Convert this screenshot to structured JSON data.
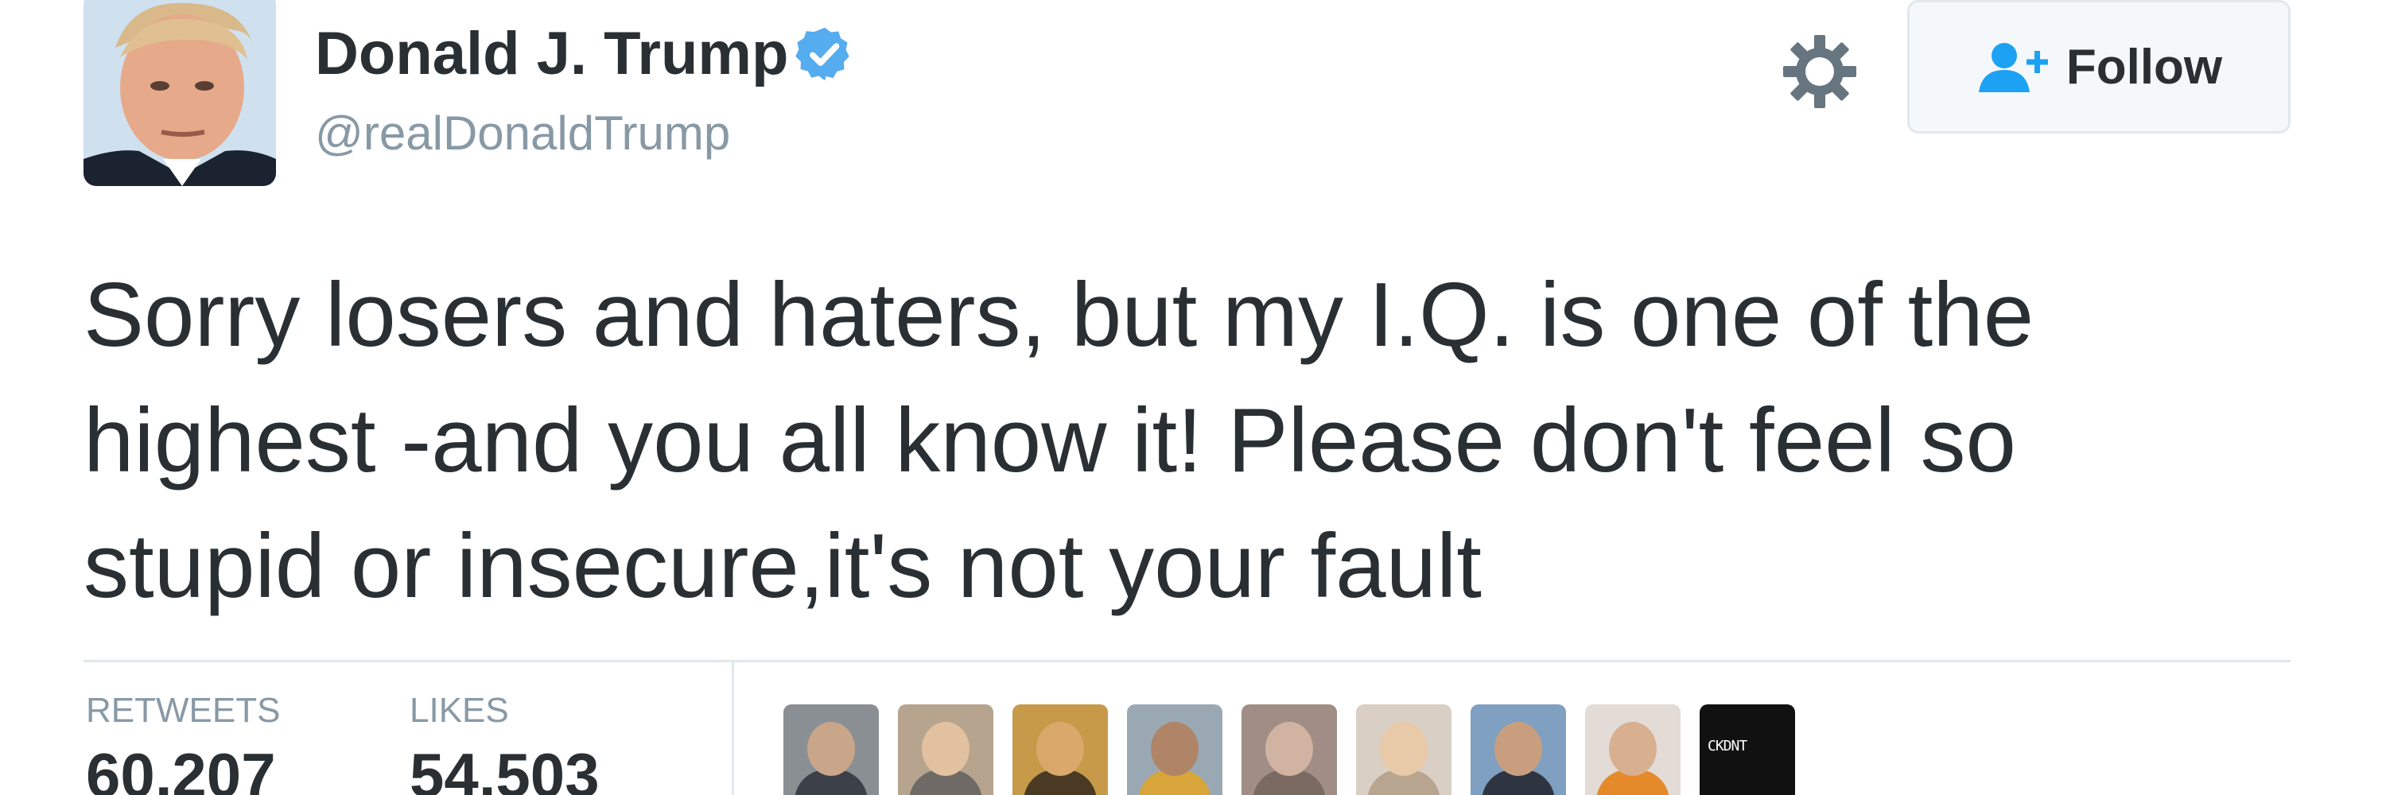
{
  "user": {
    "display_name": "Donald J. Trump",
    "handle": "@realDonaldTrump",
    "avatar_icon": "profile-photo",
    "verified_icon": "verified-badge-icon",
    "verified_color": "#55acee"
  },
  "actions": {
    "settings_icon": "gear-icon",
    "follow_label": "Follow",
    "follow_icon": "add-user-icon",
    "follow_icon_color": "#1da1f2"
  },
  "tweet": {
    "lines": [
      "Sorry losers and haters, but my I.Q. is one of the",
      "highest -and you all know it! Please don't feel so",
      "stupid or insecure,it's not your fault"
    ]
  },
  "stats": {
    "retweets_label": "RETWEETS",
    "retweets_value": "60,207",
    "likes_label": "LIKES",
    "likes_value": "54,503"
  },
  "likers": [
    {
      "name": "liker-avatar-1",
      "bg": "#8a8f94",
      "skin": "#c9a58a",
      "cloth": "#3c4048"
    },
    {
      "name": "liker-avatar-2",
      "bg": "#b7a48e",
      "skin": "#e2c1a0",
      "cloth": "#6f6a66"
    },
    {
      "name": "liker-avatar-3",
      "bg": "#c79a4a",
      "skin": "#d9a86a",
      "cloth": "#4a3a24"
    },
    {
      "name": "liker-avatar-4",
      "bg": "#9aa8b4",
      "skin": "#b08466",
      "cloth": "#d8a53a"
    },
    {
      "name": "liker-avatar-5",
      "bg": "#a08d86",
      "skin": "#d0b3a0",
      "cloth": "#7a6a62"
    },
    {
      "name": "liker-avatar-6",
      "bg": "#d9cfc4",
      "skin": "#e8c9a8",
      "cloth": "#b8a58f"
    },
    {
      "name": "liker-avatar-7",
      "bg": "#7fa0c0",
      "skin": "#c99e7e",
      "cloth": "#2e3440"
    },
    {
      "name": "liker-avatar-8",
      "bg": "#e3dbd6",
      "skin": "#d8b090",
      "cloth": "#e48a2a"
    },
    {
      "name": "liker-avatar-9",
      "bg": "#111111",
      "skin": "#111111",
      "cloth": "#111111",
      "text": "CKDNT"
    }
  ]
}
